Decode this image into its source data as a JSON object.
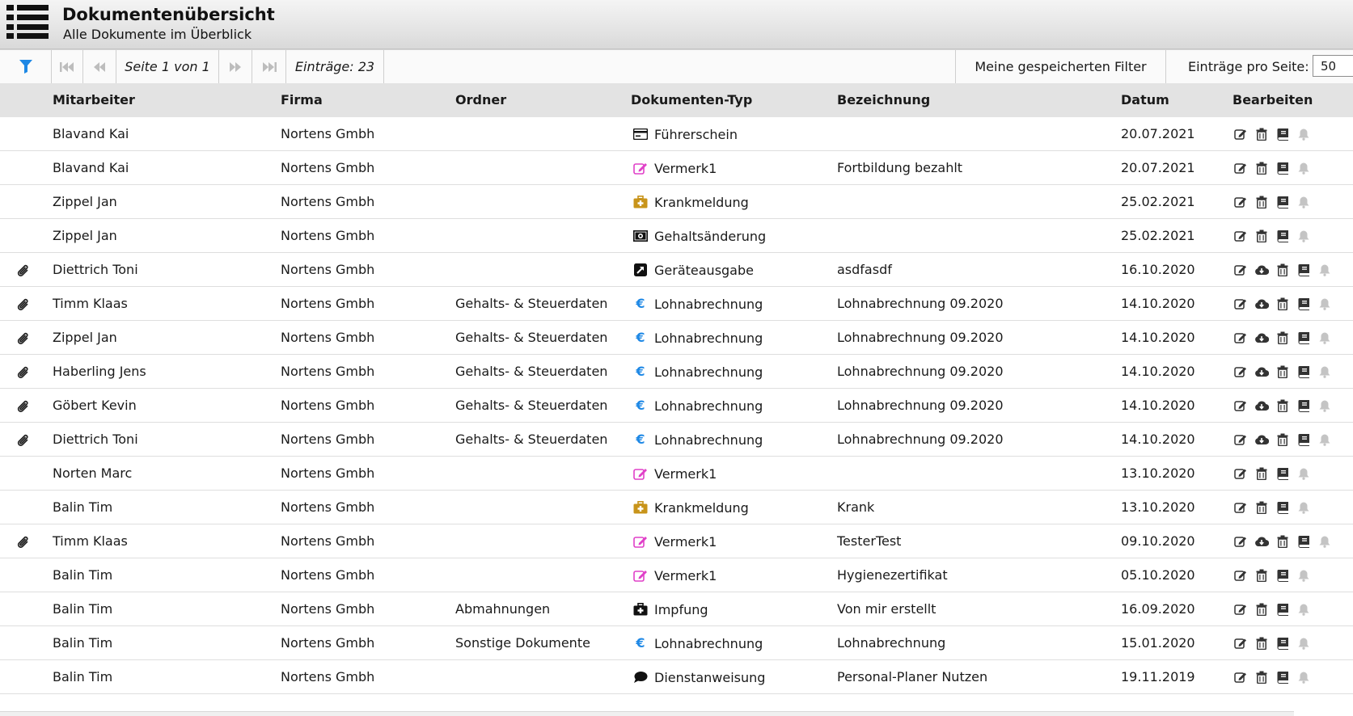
{
  "header": {
    "title": "Dokumentenübersicht",
    "subtitle": "Alle Dokumente im Überblick"
  },
  "toolbar": {
    "page_info": "Seite 1 von 1",
    "entries": "Einträge: 23",
    "saved_filters": "Meine gespeicherten Filter",
    "per_page_label": "Einträge pro Seite:",
    "per_page_value": "50",
    "filter_color": "#1e88e5"
  },
  "columns": {
    "employee": "Mitarbeiter",
    "company": "Firma",
    "folder": "Ordner",
    "doc_type": "Dokumenten-Typ",
    "description": "Bezeichnung",
    "date": "Datum",
    "edit": "Bearbeiten"
  },
  "type_icons": {
    "Führerschein": {
      "icon": "id-card-icon",
      "color": "#111111"
    },
    "Vermerk1": {
      "icon": "note-edit-icon",
      "color": "#e040c8"
    },
    "Krankmeldung": {
      "icon": "medical-kit-icon",
      "color": "#c8941a"
    },
    "Gehaltsänderung": {
      "icon": "money-bill-icon",
      "color": "#111111"
    },
    "Geräteausgabe": {
      "icon": "external-link-icon",
      "color": "#111111"
    },
    "Lohnabrechnung": {
      "icon": "euro-icon",
      "color": "#1e88e5"
    },
    "Impfung": {
      "icon": "first-aid-icon",
      "color": "#111111"
    },
    "Dienstanweisung": {
      "icon": "speech-bubble-icon",
      "color": "#111111"
    }
  },
  "rows": [
    {
      "attachment": false,
      "employee": "Blavand Kai",
      "company": "Nortens Gmbh",
      "folder": "",
      "type": "Führerschein",
      "description": "",
      "date": "20.07.2021",
      "download": false
    },
    {
      "attachment": false,
      "employee": "Blavand Kai",
      "company": "Nortens Gmbh",
      "folder": "",
      "type": "Vermerk1",
      "description": "Fortbildung bezahlt",
      "date": "20.07.2021",
      "download": false
    },
    {
      "attachment": false,
      "employee": "Zippel Jan",
      "company": "Nortens Gmbh",
      "folder": "",
      "type": "Krankmeldung",
      "description": "",
      "date": "25.02.2021",
      "download": false
    },
    {
      "attachment": false,
      "employee": "Zippel Jan",
      "company": "Nortens Gmbh",
      "folder": "",
      "type": "Gehaltsänderung",
      "description": "",
      "date": "25.02.2021",
      "download": false
    },
    {
      "attachment": true,
      "employee": "Diettrich Toni",
      "company": "Nortens Gmbh",
      "folder": "",
      "type": "Geräteausgabe",
      "description": "asdfasdf",
      "date": "16.10.2020",
      "download": true
    },
    {
      "attachment": true,
      "employee": "Timm Klaas",
      "company": "Nortens Gmbh",
      "folder": "Gehalts- & Steuerdaten",
      "type": "Lohnabrechnung",
      "description": "Lohnabrechnung 09.2020",
      "date": "14.10.2020",
      "download": true
    },
    {
      "attachment": true,
      "employee": "Zippel Jan",
      "company": "Nortens Gmbh",
      "folder": "Gehalts- & Steuerdaten",
      "type": "Lohnabrechnung",
      "description": "Lohnabrechnung 09.2020",
      "date": "14.10.2020",
      "download": true
    },
    {
      "attachment": true,
      "employee": "Haberling Jens",
      "company": "Nortens Gmbh",
      "folder": "Gehalts- & Steuerdaten",
      "type": "Lohnabrechnung",
      "description": "Lohnabrechnung 09.2020",
      "date": "14.10.2020",
      "download": true
    },
    {
      "attachment": true,
      "employee": "Göbert Kevin",
      "company": "Nortens Gmbh",
      "folder": "Gehalts- & Steuerdaten",
      "type": "Lohnabrechnung",
      "description": "Lohnabrechnung 09.2020",
      "date": "14.10.2020",
      "download": true
    },
    {
      "attachment": true,
      "employee": "Diettrich Toni",
      "company": "Nortens Gmbh",
      "folder": "Gehalts- & Steuerdaten",
      "type": "Lohnabrechnung",
      "description": "Lohnabrechnung 09.2020",
      "date": "14.10.2020",
      "download": true
    },
    {
      "attachment": false,
      "employee": "Norten Marc",
      "company": "Nortens Gmbh",
      "folder": "",
      "type": "Vermerk1",
      "description": "",
      "date": "13.10.2020",
      "download": false
    },
    {
      "attachment": false,
      "employee": "Balin Tim",
      "company": "Nortens Gmbh",
      "folder": "",
      "type": "Krankmeldung",
      "description": "Krank",
      "date": "13.10.2020",
      "download": false
    },
    {
      "attachment": true,
      "employee": "Timm Klaas",
      "company": "Nortens Gmbh",
      "folder": "",
      "type": "Vermerk1",
      "description": "TesterTest",
      "date": "09.10.2020",
      "download": true
    },
    {
      "attachment": false,
      "employee": "Balin Tim",
      "company": "Nortens Gmbh",
      "folder": "",
      "type": "Vermerk1",
      "description": "Hygienezertifikat",
      "date": "05.10.2020",
      "download": false
    },
    {
      "attachment": false,
      "employee": "Balin Tim",
      "company": "Nortens Gmbh",
      "folder": "Abmahnungen",
      "type": "Impfung",
      "description": "Von mir erstellt",
      "date": "16.09.2020",
      "download": false
    },
    {
      "attachment": false,
      "employee": "Balin Tim",
      "company": "Nortens Gmbh",
      "folder": "Sonstige Dokumente",
      "type": "Lohnabrechnung",
      "description": "Lohnabrechnung",
      "date": "15.01.2020",
      "download": false
    },
    {
      "attachment": false,
      "employee": "Balin Tim",
      "company": "Nortens Gmbh",
      "folder": "",
      "type": "Dienstanweisung",
      "description": "Personal-Planer Nutzen",
      "date": "19.11.2019",
      "download": false
    }
  ]
}
